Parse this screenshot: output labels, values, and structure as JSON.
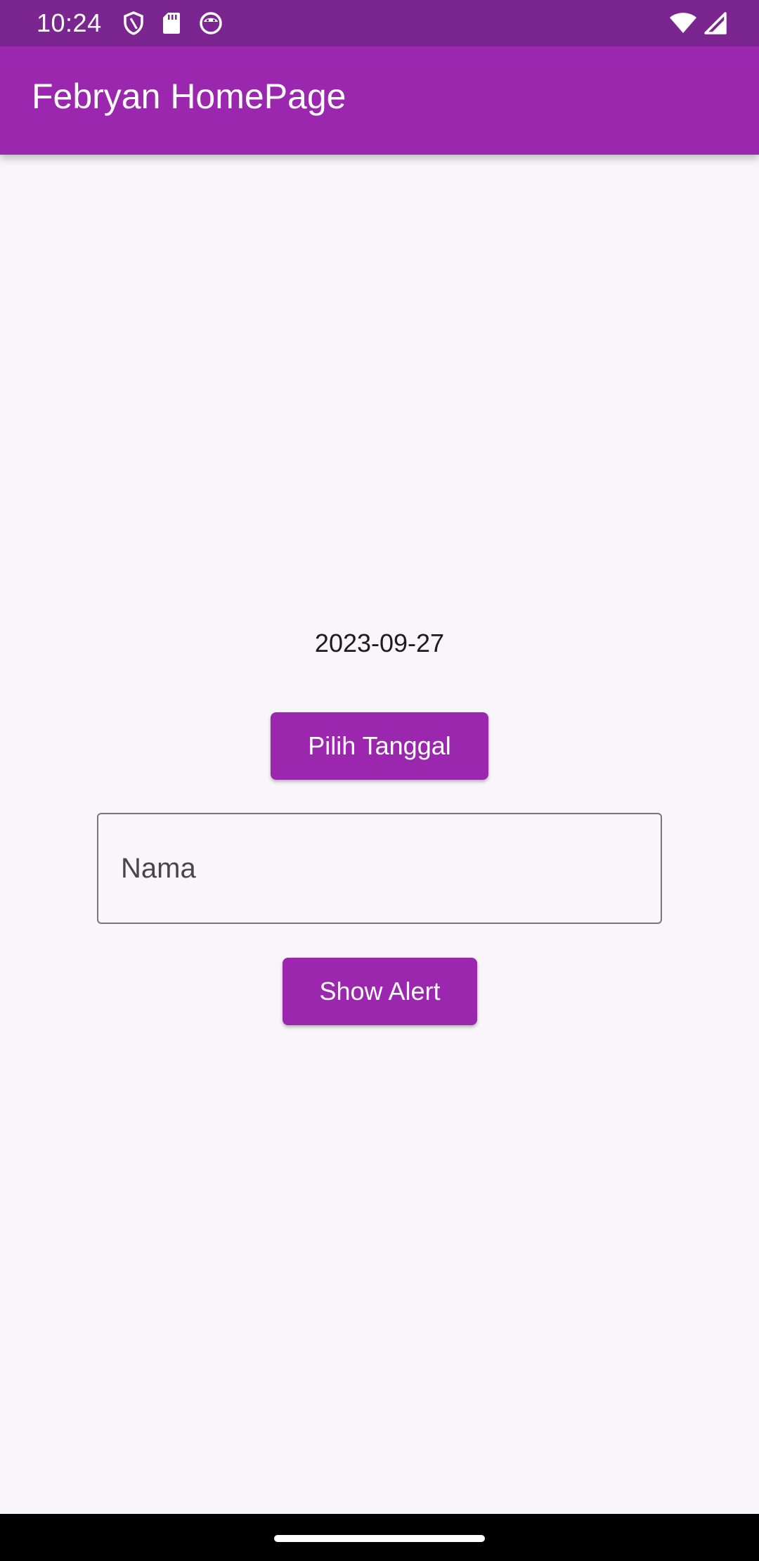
{
  "status_bar": {
    "time": "10:24",
    "left_icons": [
      "shield-icon",
      "sd-card-icon",
      "android-face-icon"
    ],
    "right_icons": [
      "wifi-icon",
      "signal-icon"
    ]
  },
  "app_bar": {
    "title": "Febryan HomePage"
  },
  "main": {
    "selected_date": "2023-09-27",
    "pick_date_label": "Pilih Tanggal",
    "name_input": {
      "placeholder": "Nama",
      "value": ""
    },
    "show_alert_label": "Show Alert"
  },
  "colors": {
    "status_bar": "#7b2590",
    "primary": "#9b27af",
    "background": "#f8f6f9",
    "nav_bar": "#000000"
  }
}
